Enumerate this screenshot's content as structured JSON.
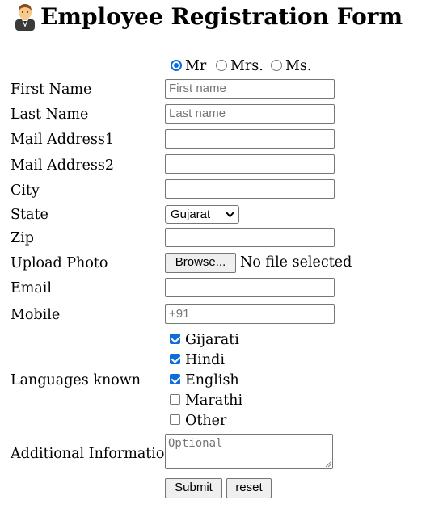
{
  "header": {
    "title": "Employee Registration Form"
  },
  "title_options": {
    "mr": "Mr",
    "mrs": "Mrs.",
    "ms": "Ms.",
    "selected": "Mr"
  },
  "fields": {
    "first_name": {
      "label": "First Name",
      "placeholder": "First name"
    },
    "last_name": {
      "label": "Last Name",
      "placeholder": "Last name"
    },
    "mail1": {
      "label": "Mail Address1"
    },
    "mail2": {
      "label": "Mail Address2"
    },
    "city": {
      "label": "City"
    },
    "state": {
      "label": "State",
      "value": "Gujarat"
    },
    "zip": {
      "label": "Zip"
    },
    "photo": {
      "label": "Upload Photo",
      "button": "Browse...",
      "status": "No file selected"
    },
    "email": {
      "label": "Email"
    },
    "mobile": {
      "label": "Mobile",
      "placeholder": "+91"
    },
    "languages": {
      "label": "Languages known",
      "options": [
        {
          "label": "Gijarati",
          "checked": true
        },
        {
          "label": "Hindi",
          "checked": true
        },
        {
          "label": "English",
          "checked": true
        },
        {
          "label": "Marathi",
          "checked": false
        },
        {
          "label": "Other",
          "checked": false
        }
      ]
    },
    "additional": {
      "label": "Additional Information",
      "placeholder": "Optional"
    }
  },
  "buttons": {
    "submit": "Submit",
    "reset": "reset"
  },
  "colors": {
    "accent": "#0f6cdd",
    "border": "#767676",
    "button_bg": "#efefef"
  }
}
